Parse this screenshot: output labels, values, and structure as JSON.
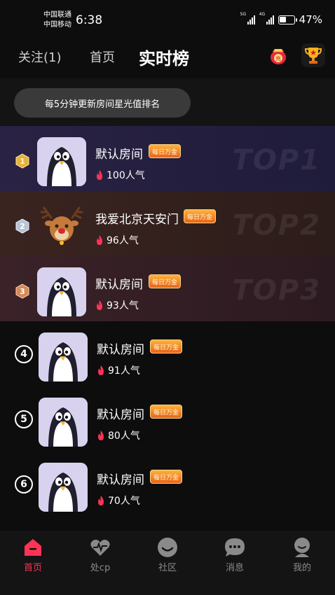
{
  "status_bar": {
    "carrier1": "中国联通",
    "carrier2": "中国移动",
    "time": "6:38",
    "sig1": "5G",
    "sig2": "4G",
    "battery": "47%"
  },
  "header": {
    "tab_follow": "关注(1)",
    "tab_home": "首页",
    "tab_realtime": "实时榜",
    "gift_icon": "red-envelope-icon",
    "trophy_icon": "trophy-icon",
    "gift_text": "充"
  },
  "info_pill": "每5分钟更新房间星光值排名",
  "ranking": [
    {
      "rank": "1",
      "name": "默认房间",
      "badge": "每日万金",
      "popularity": "100人气",
      "top_label": "TOP1",
      "avatar": "penguin"
    },
    {
      "rank": "2",
      "name": "我爱北京天安门",
      "badge": "每日万金",
      "popularity": "96人气",
      "top_label": "TOP2",
      "avatar": "deer"
    },
    {
      "rank": "3",
      "name": "默认房间",
      "badge": "每日万金",
      "popularity": "93人气",
      "top_label": "TOP3",
      "avatar": "penguin"
    },
    {
      "rank": "4",
      "name": "默认房间",
      "badge": "每日万金",
      "popularity": "91人气",
      "avatar": "penguin"
    },
    {
      "rank": "5",
      "name": "默认房间",
      "badge": "每日万金",
      "popularity": "80人气",
      "avatar": "penguin"
    },
    {
      "rank": "6",
      "name": "默认房间",
      "badge": "每日万金",
      "popularity": "70人气",
      "avatar": "penguin"
    }
  ],
  "nav": [
    {
      "label": "首页",
      "icon": "home-icon",
      "active": true
    },
    {
      "label": "处cp",
      "icon": "heartbeat-icon",
      "active": false
    },
    {
      "label": "社区",
      "icon": "community-icon",
      "active": false
    },
    {
      "label": "消息",
      "icon": "message-icon",
      "active": false
    },
    {
      "label": "我的",
      "icon": "profile-icon",
      "active": false
    }
  ],
  "colors": {
    "accent": "#ff3355",
    "badge": "#e8641a",
    "flame": "#ff3355"
  }
}
